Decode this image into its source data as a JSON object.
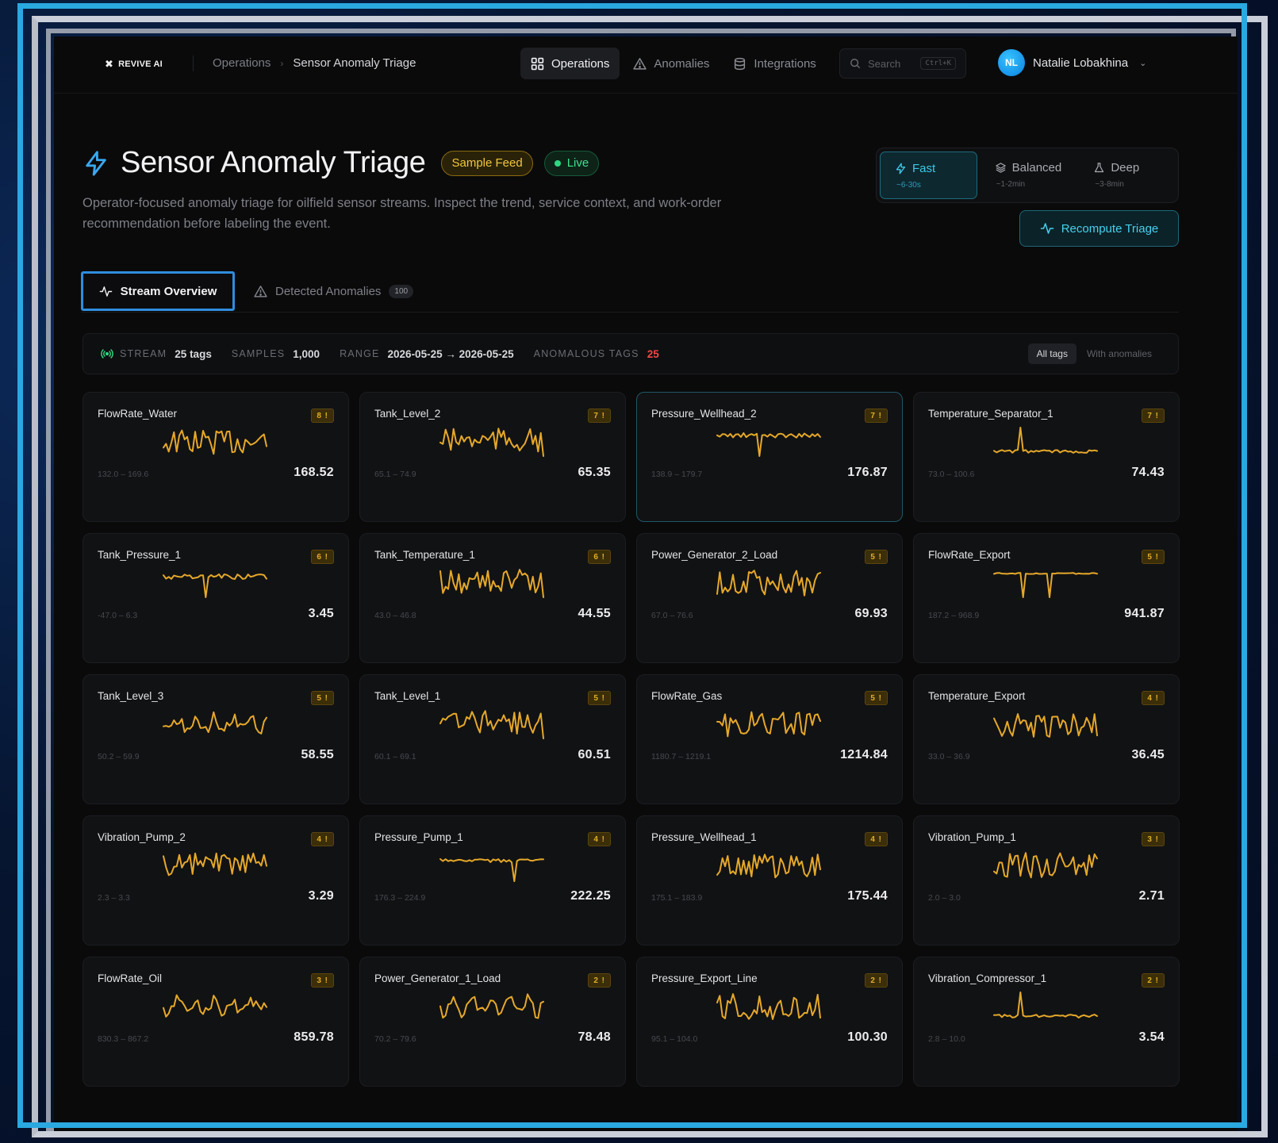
{
  "app": {
    "brand": "REVIVE AI",
    "breadcrumb": [
      "Operations",
      "Sensor Anomaly Triage"
    ]
  },
  "nav": [
    {
      "label": "Operations",
      "icon": "grid-icon",
      "active": true
    },
    {
      "label": "Anomalies",
      "icon": "warning-triangle-icon",
      "active": false
    },
    {
      "label": "Integrations",
      "icon": "database-icon",
      "active": false
    }
  ],
  "search": {
    "placeholder": "Search",
    "shortcut": "Ctrl+K"
  },
  "user": {
    "initials": "NL",
    "name": "Natalie Lobakhina"
  },
  "page": {
    "title": "Sensor Anomaly Triage",
    "badge_sample": "Sample Feed",
    "badge_live": "Live",
    "subtitle": "Operator-focused anomaly triage for oilfield sensor streams. Inspect the trend, service context, and work-order recommendation before labeling the event."
  },
  "modes": [
    {
      "label": "Fast",
      "sub": "~6-30s",
      "icon": "bolt-icon",
      "active": true
    },
    {
      "label": "Balanced",
      "sub": "~1-2min",
      "icon": "layers-icon",
      "active": false
    },
    {
      "label": "Deep",
      "sub": "~3-8min",
      "icon": "flask-icon",
      "active": false
    }
  ],
  "recompute_label": "Recompute Triage",
  "tabs": [
    {
      "label": "Stream Overview",
      "active": true
    },
    {
      "label": "Detected Anomalies",
      "count": "100",
      "active": false
    }
  ],
  "stats": {
    "stream_label": "STREAM",
    "stream_value": "25 tags",
    "samples_label": "SAMPLES",
    "samples_value": "1,000",
    "range_label": "RANGE",
    "range_value": "2026-05-25 → 2026-05-25",
    "anom_label": "ANOMALOUS TAGS",
    "anom_value": "25",
    "filter_all": "All tags",
    "filter_anom": "With anomalies"
  },
  "colors": {
    "accent": "#3ec9e8",
    "spark": "#e5a82a",
    "warning_red": "#f04848",
    "live_green": "#2fd880"
  },
  "sensors": [
    {
      "name": "FlowRate_Water",
      "count": "8 !",
      "range": "132.0 – 169.6",
      "value": "168.52",
      "pattern": "noisy"
    },
    {
      "name": "Tank_Level_2",
      "count": "7 !",
      "range": "65.1 – 74.9",
      "value": "65.35",
      "pattern": "noisy_drop"
    },
    {
      "name": "Pressure_Wellhead_2",
      "count": "7 !",
      "range": "138.9 – 179.7",
      "value": "176.87",
      "pattern": "spike_down",
      "highlighted": true
    },
    {
      "name": "Temperature_Separator_1",
      "count": "7 !",
      "range": "73.0 – 100.6",
      "value": "74.43",
      "pattern": "spike_up"
    },
    {
      "name": "Tank_Pressure_1",
      "count": "6 !",
      "range": "-47.0 – 6.3",
      "value": "3.45",
      "pattern": "spike_down"
    },
    {
      "name": "Tank_Temperature_1",
      "count": "6 !",
      "range": "43.0 – 46.8",
      "value": "44.55",
      "pattern": "noisy_drop"
    },
    {
      "name": "Power_Generator_2_Load",
      "count": "5 !",
      "range": "67.0 – 76.6",
      "value": "69.93",
      "pattern": "noisy"
    },
    {
      "name": "FlowRate_Export",
      "count": "5 !",
      "range": "187.2 – 968.9",
      "value": "941.87",
      "pattern": "double_spike_down"
    },
    {
      "name": "Tank_Level_3",
      "count": "5 !",
      "range": "50.2 – 59.9",
      "value": "58.55",
      "pattern": "wave"
    },
    {
      "name": "Tank_Level_1",
      "count": "5 !",
      "range": "60.1 – 69.1",
      "value": "60.51",
      "pattern": "noisy_drop"
    },
    {
      "name": "FlowRate_Gas",
      "count": "5 !",
      "range": "1180.7 – 1219.1",
      "value": "1214.84",
      "pattern": "noisy"
    },
    {
      "name": "Temperature_Export",
      "count": "4 !",
      "range": "33.0 – 36.9",
      "value": "36.45",
      "pattern": "noisy"
    },
    {
      "name": "Vibration_Pump_2",
      "count": "4 !",
      "range": "2.3 – 3.3",
      "value": "3.29",
      "pattern": "noisy"
    },
    {
      "name": "Pressure_Pump_1",
      "count": "4 !",
      "range": "176.3 – 224.9",
      "value": "222.25",
      "pattern": "flat_spike_down"
    },
    {
      "name": "Pressure_Wellhead_1",
      "count": "4 !",
      "range": "175.1 – 183.9",
      "value": "175.44",
      "pattern": "noisy"
    },
    {
      "name": "Vibration_Pump_1",
      "count": "3 !",
      "range": "2.0 – 3.0",
      "value": "2.71",
      "pattern": "noisy"
    },
    {
      "name": "FlowRate_Oil",
      "count": "3 !",
      "range": "830.3 – 867.2",
      "value": "859.78",
      "pattern": "wave"
    },
    {
      "name": "Power_Generator_1_Load",
      "count": "2 !",
      "range": "70.2 – 79.6",
      "value": "78.48",
      "pattern": "wave"
    },
    {
      "name": "Pressure_Export_Line",
      "count": "2 !",
      "range": "95.1 – 104.0",
      "value": "100.30",
      "pattern": "noisy"
    },
    {
      "name": "Vibration_Compressor_1",
      "count": "2 !",
      "range": "2.8 – 10.0",
      "value": "3.54",
      "pattern": "spike_up"
    }
  ]
}
